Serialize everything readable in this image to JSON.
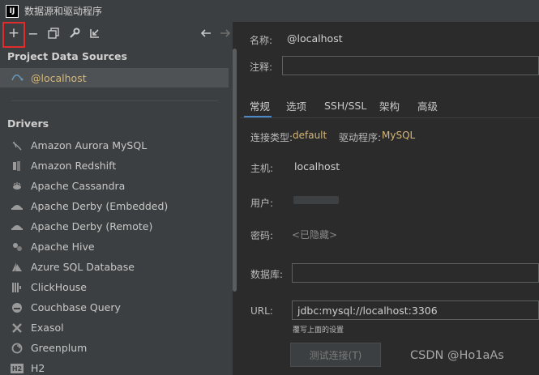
{
  "window": {
    "title": "数据源和驱动程序",
    "logo_text": "IJ"
  },
  "toolbar": {
    "add": "+",
    "remove": "−"
  },
  "left": {
    "project_header": "Project Data Sources",
    "data_source": {
      "label": "@localhost",
      "icon": "mysql-icon"
    },
    "drivers_header": "Drivers",
    "drivers": [
      {
        "label": "Amazon Aurora MySQL",
        "icon": "aurora-icon"
      },
      {
        "label": "Amazon Redshift",
        "icon": "redshift-icon"
      },
      {
        "label": "Apache Cassandra",
        "icon": "cassandra-icon"
      },
      {
        "label": "Apache Derby (Embedded)",
        "icon": "derby-icon"
      },
      {
        "label": "Apache Derby (Remote)",
        "icon": "derby-icon"
      },
      {
        "label": "Apache Hive",
        "icon": "hive-icon"
      },
      {
        "label": "Azure SQL Database",
        "icon": "azure-icon"
      },
      {
        "label": "ClickHouse",
        "icon": "clickhouse-icon"
      },
      {
        "label": "Couchbase Query",
        "icon": "couchbase-icon"
      },
      {
        "label": "Exasol",
        "icon": "exasol-icon"
      },
      {
        "label": "Greenplum",
        "icon": "greenplum-icon"
      },
      {
        "label": "H2",
        "icon": "h2-icon"
      }
    ]
  },
  "right": {
    "name_label": "名称:",
    "name_value": "@localhost",
    "comment_label": "注释:",
    "comment_value": "",
    "tabs": [
      "常规",
      "选项",
      "SSH/SSL",
      "架构",
      "高级"
    ],
    "conn_type_label": "连接类型:",
    "conn_type_value": "default",
    "driver_label": "驱动程序:",
    "driver_value": "MySQL",
    "host_label": "主机:",
    "host_value": "localhost",
    "user_label": "用户:",
    "password_label": "密码:",
    "password_value": "<已隐藏>",
    "database_label": "数据库:",
    "database_value": "",
    "url_label": "URL:",
    "url_value": "jdbc:mysql://localhost:3306",
    "url_hint": "覆写上面的设置",
    "test_button": "测试连接(T)"
  },
  "watermark": "CSDN @Ho1aAs",
  "colors": {
    "accent": "#d5b778",
    "highlight": "#e22b2b",
    "tab_underline": "#4a88c7"
  }
}
